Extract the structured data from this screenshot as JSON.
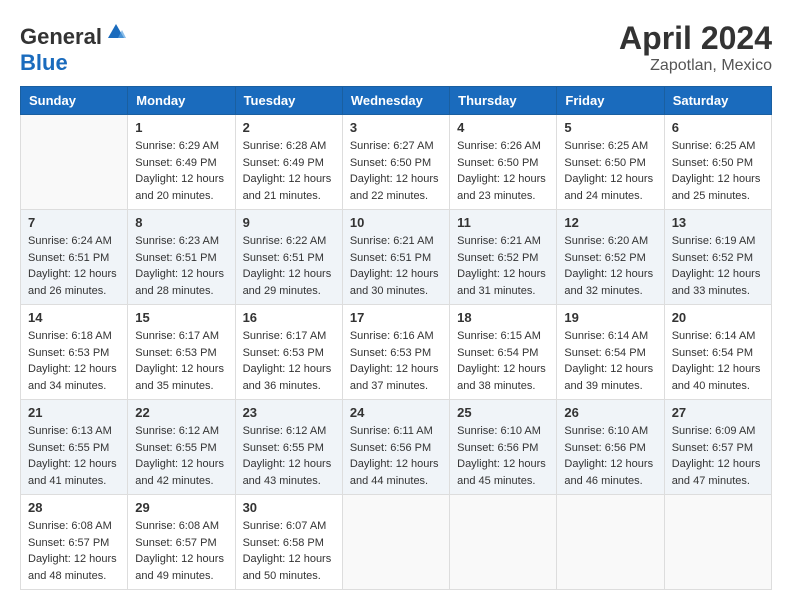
{
  "header": {
    "logo_general": "General",
    "logo_blue": "Blue",
    "month": "April 2024",
    "location": "Zapotlan, Mexico"
  },
  "weekdays": [
    "Sunday",
    "Monday",
    "Tuesday",
    "Wednesday",
    "Thursday",
    "Friday",
    "Saturday"
  ],
  "weeks": [
    [
      {
        "day": "",
        "sunrise": "",
        "sunset": "",
        "daylight": ""
      },
      {
        "day": "1",
        "sunrise": "Sunrise: 6:29 AM",
        "sunset": "Sunset: 6:49 PM",
        "daylight": "Daylight: 12 hours and 20 minutes."
      },
      {
        "day": "2",
        "sunrise": "Sunrise: 6:28 AM",
        "sunset": "Sunset: 6:49 PM",
        "daylight": "Daylight: 12 hours and 21 minutes."
      },
      {
        "day": "3",
        "sunrise": "Sunrise: 6:27 AM",
        "sunset": "Sunset: 6:50 PM",
        "daylight": "Daylight: 12 hours and 22 minutes."
      },
      {
        "day": "4",
        "sunrise": "Sunrise: 6:26 AM",
        "sunset": "Sunset: 6:50 PM",
        "daylight": "Daylight: 12 hours and 23 minutes."
      },
      {
        "day": "5",
        "sunrise": "Sunrise: 6:25 AM",
        "sunset": "Sunset: 6:50 PM",
        "daylight": "Daylight: 12 hours and 24 minutes."
      },
      {
        "day": "6",
        "sunrise": "Sunrise: 6:25 AM",
        "sunset": "Sunset: 6:50 PM",
        "daylight": "Daylight: 12 hours and 25 minutes."
      }
    ],
    [
      {
        "day": "7",
        "sunrise": "Sunrise: 6:24 AM",
        "sunset": "Sunset: 6:51 PM",
        "daylight": "Daylight: 12 hours and 26 minutes."
      },
      {
        "day": "8",
        "sunrise": "Sunrise: 6:23 AM",
        "sunset": "Sunset: 6:51 PM",
        "daylight": "Daylight: 12 hours and 28 minutes."
      },
      {
        "day": "9",
        "sunrise": "Sunrise: 6:22 AM",
        "sunset": "Sunset: 6:51 PM",
        "daylight": "Daylight: 12 hours and 29 minutes."
      },
      {
        "day": "10",
        "sunrise": "Sunrise: 6:21 AM",
        "sunset": "Sunset: 6:51 PM",
        "daylight": "Daylight: 12 hours and 30 minutes."
      },
      {
        "day": "11",
        "sunrise": "Sunrise: 6:21 AM",
        "sunset": "Sunset: 6:52 PM",
        "daylight": "Daylight: 12 hours and 31 minutes."
      },
      {
        "day": "12",
        "sunrise": "Sunrise: 6:20 AM",
        "sunset": "Sunset: 6:52 PM",
        "daylight": "Daylight: 12 hours and 32 minutes."
      },
      {
        "day": "13",
        "sunrise": "Sunrise: 6:19 AM",
        "sunset": "Sunset: 6:52 PM",
        "daylight": "Daylight: 12 hours and 33 minutes."
      }
    ],
    [
      {
        "day": "14",
        "sunrise": "Sunrise: 6:18 AM",
        "sunset": "Sunset: 6:53 PM",
        "daylight": "Daylight: 12 hours and 34 minutes."
      },
      {
        "day": "15",
        "sunrise": "Sunrise: 6:17 AM",
        "sunset": "Sunset: 6:53 PM",
        "daylight": "Daylight: 12 hours and 35 minutes."
      },
      {
        "day": "16",
        "sunrise": "Sunrise: 6:17 AM",
        "sunset": "Sunset: 6:53 PM",
        "daylight": "Daylight: 12 hours and 36 minutes."
      },
      {
        "day": "17",
        "sunrise": "Sunrise: 6:16 AM",
        "sunset": "Sunset: 6:53 PM",
        "daylight": "Daylight: 12 hours and 37 minutes."
      },
      {
        "day": "18",
        "sunrise": "Sunrise: 6:15 AM",
        "sunset": "Sunset: 6:54 PM",
        "daylight": "Daylight: 12 hours and 38 minutes."
      },
      {
        "day": "19",
        "sunrise": "Sunrise: 6:14 AM",
        "sunset": "Sunset: 6:54 PM",
        "daylight": "Daylight: 12 hours and 39 minutes."
      },
      {
        "day": "20",
        "sunrise": "Sunrise: 6:14 AM",
        "sunset": "Sunset: 6:54 PM",
        "daylight": "Daylight: 12 hours and 40 minutes."
      }
    ],
    [
      {
        "day": "21",
        "sunrise": "Sunrise: 6:13 AM",
        "sunset": "Sunset: 6:55 PM",
        "daylight": "Daylight: 12 hours and 41 minutes."
      },
      {
        "day": "22",
        "sunrise": "Sunrise: 6:12 AM",
        "sunset": "Sunset: 6:55 PM",
        "daylight": "Daylight: 12 hours and 42 minutes."
      },
      {
        "day": "23",
        "sunrise": "Sunrise: 6:12 AM",
        "sunset": "Sunset: 6:55 PM",
        "daylight": "Daylight: 12 hours and 43 minutes."
      },
      {
        "day": "24",
        "sunrise": "Sunrise: 6:11 AM",
        "sunset": "Sunset: 6:56 PM",
        "daylight": "Daylight: 12 hours and 44 minutes."
      },
      {
        "day": "25",
        "sunrise": "Sunrise: 6:10 AM",
        "sunset": "Sunset: 6:56 PM",
        "daylight": "Daylight: 12 hours and 45 minutes."
      },
      {
        "day": "26",
        "sunrise": "Sunrise: 6:10 AM",
        "sunset": "Sunset: 6:56 PM",
        "daylight": "Daylight: 12 hours and 46 minutes."
      },
      {
        "day": "27",
        "sunrise": "Sunrise: 6:09 AM",
        "sunset": "Sunset: 6:57 PM",
        "daylight": "Daylight: 12 hours and 47 minutes."
      }
    ],
    [
      {
        "day": "28",
        "sunrise": "Sunrise: 6:08 AM",
        "sunset": "Sunset: 6:57 PM",
        "daylight": "Daylight: 12 hours and 48 minutes."
      },
      {
        "day": "29",
        "sunrise": "Sunrise: 6:08 AM",
        "sunset": "Sunset: 6:57 PM",
        "daylight": "Daylight: 12 hours and 49 minutes."
      },
      {
        "day": "30",
        "sunrise": "Sunrise: 6:07 AM",
        "sunset": "Sunset: 6:58 PM",
        "daylight": "Daylight: 12 hours and 50 minutes."
      },
      {
        "day": "",
        "sunrise": "",
        "sunset": "",
        "daylight": ""
      },
      {
        "day": "",
        "sunrise": "",
        "sunset": "",
        "daylight": ""
      },
      {
        "day": "",
        "sunrise": "",
        "sunset": "",
        "daylight": ""
      },
      {
        "day": "",
        "sunrise": "",
        "sunset": "",
        "daylight": ""
      }
    ]
  ]
}
